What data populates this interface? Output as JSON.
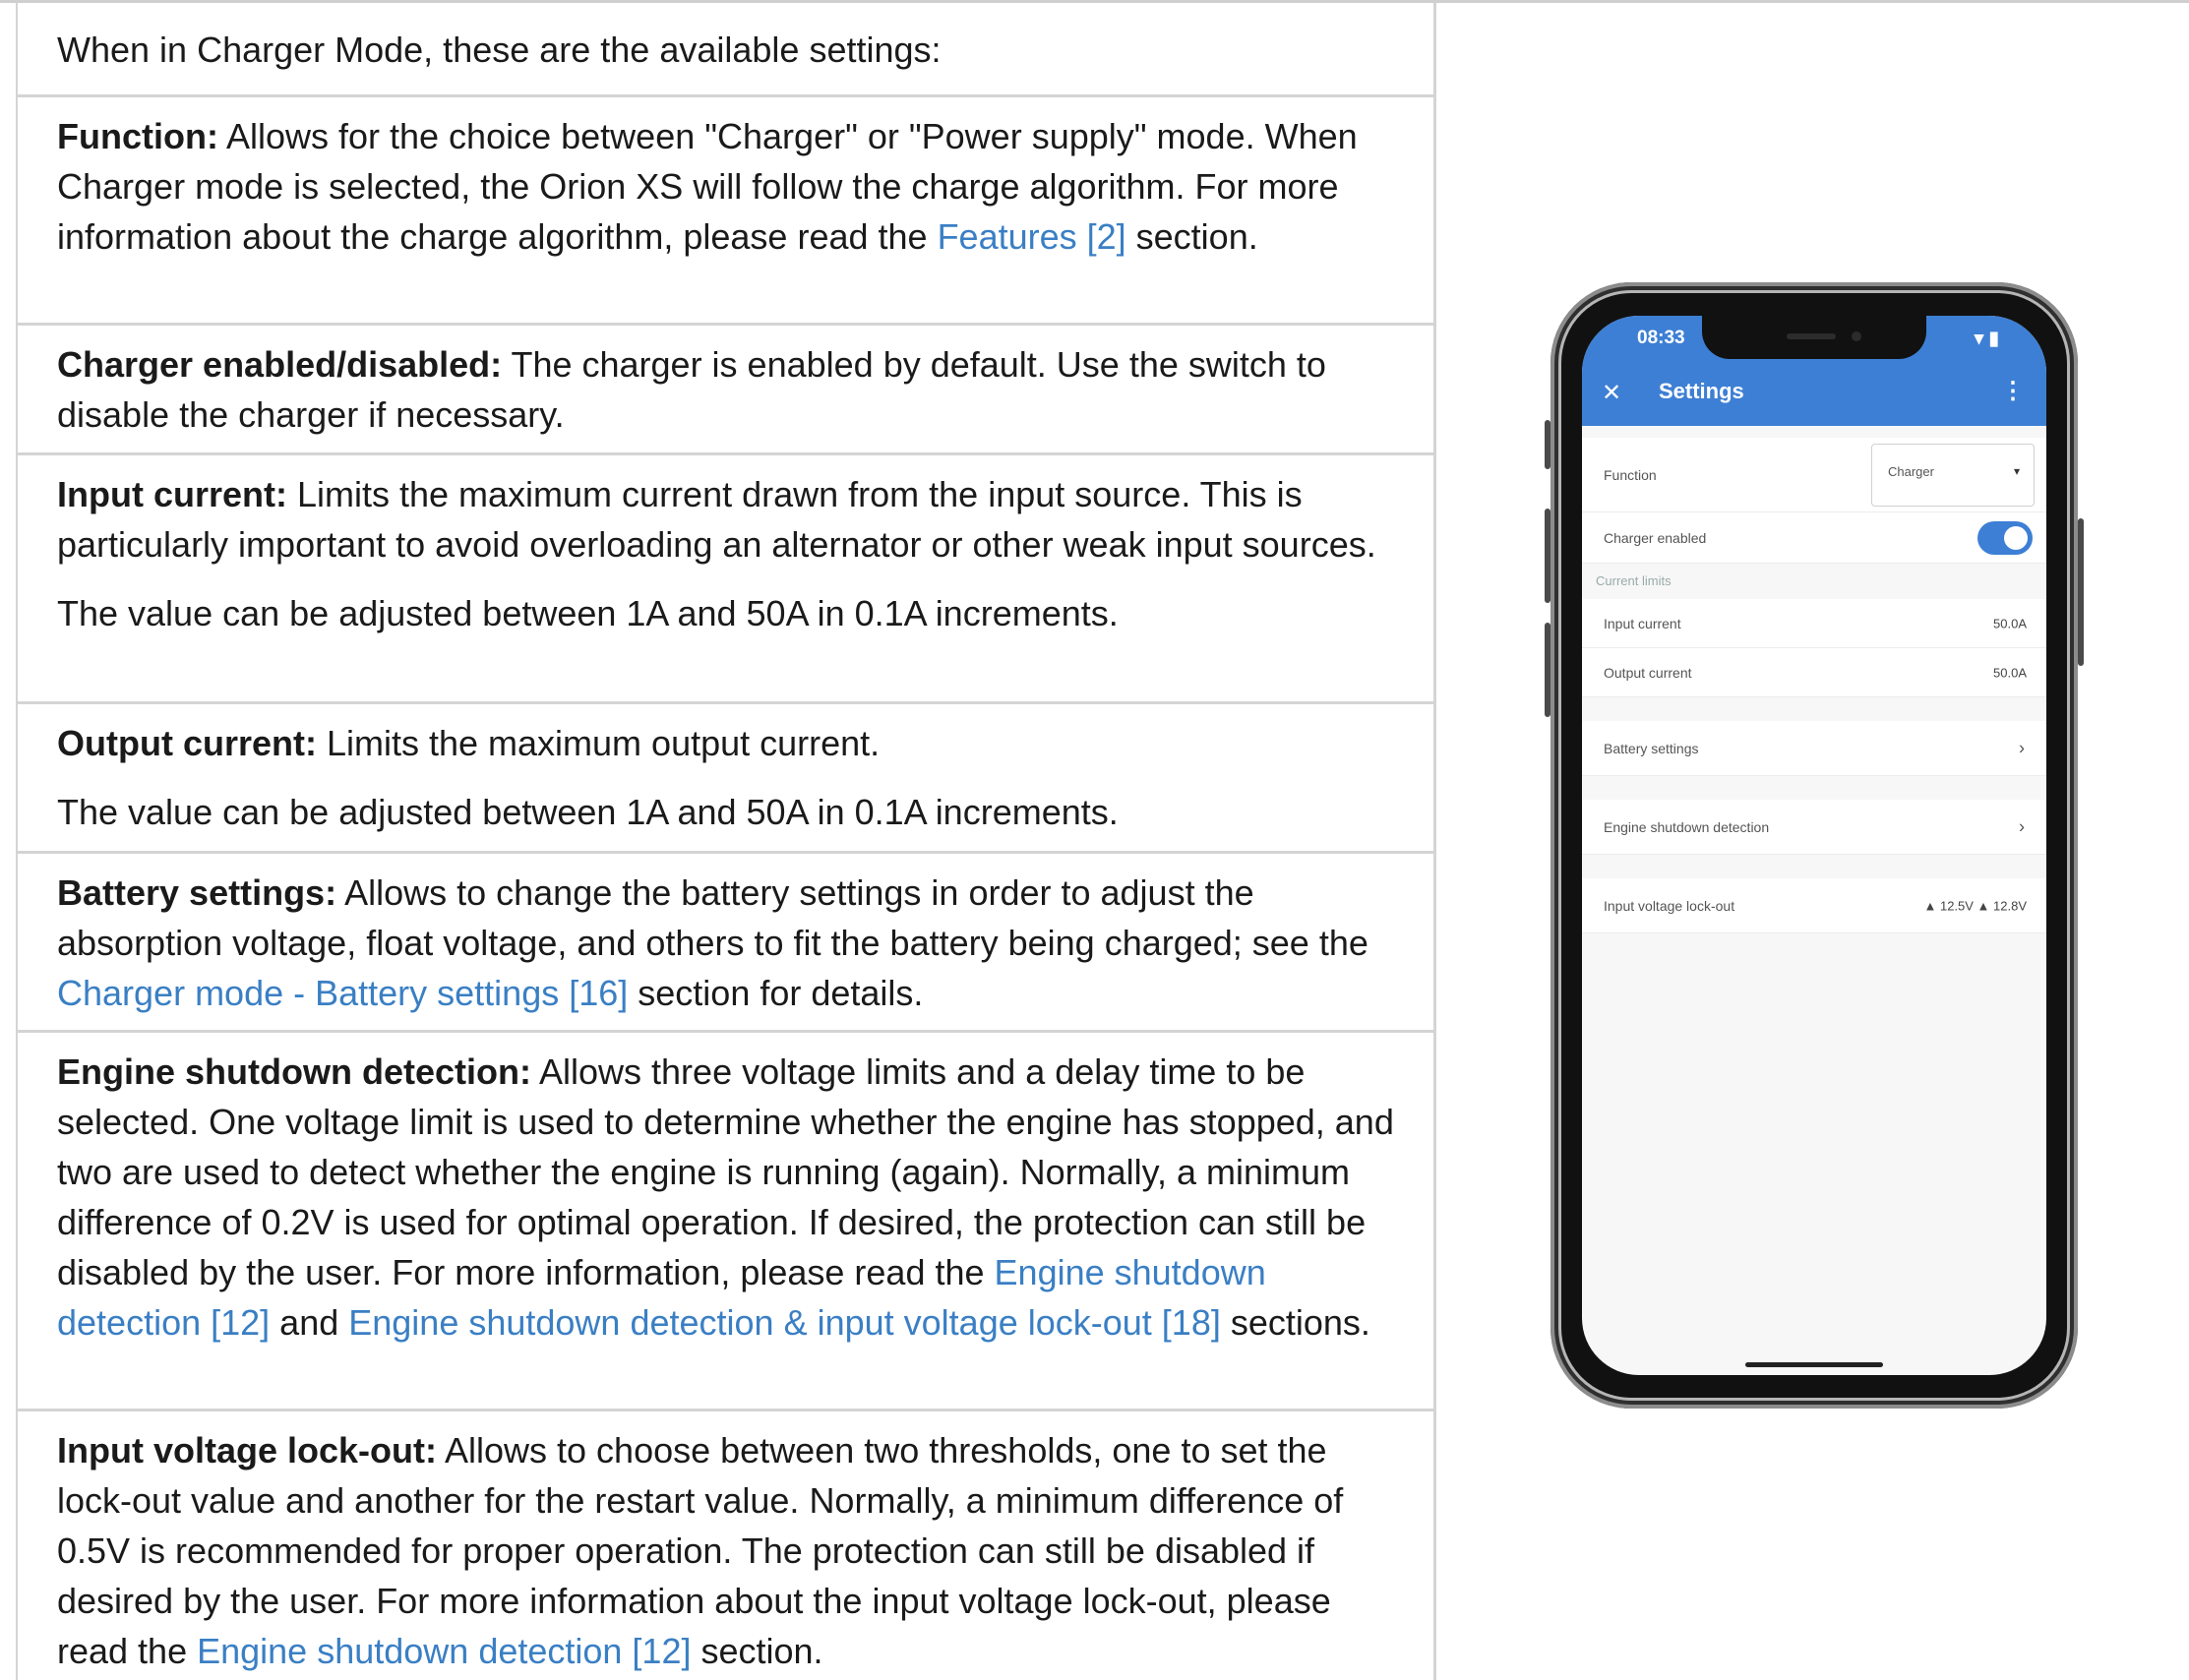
{
  "rows": [
    {
      "text": "When in Charger Mode, these are the available settings:"
    },
    {
      "term": "Function:",
      "text": " Allows for the choice between \"Charger\" or \"Power supply\" mode. When Charger mode is selected, the Orion XS will follow the charge algorithm. For more information about the charge algorithm, please read the ",
      "link1": "Features [2]",
      "tail": " section."
    },
    {
      "term": "Charger enabled/disabled:",
      "text": " The charger is enabled by default. Use the switch to disable the charger if necessary."
    },
    {
      "term": "Input current:",
      "text": " Limits the maximum current drawn from the input source. This is particularly important to avoid overloading an alternator or other weak input sources.",
      "extra": "The value can be adjusted between 1A and 50A in 0.1A increments."
    },
    {
      "term": "Output current:",
      "text": " Limits the maximum output current.",
      "extra": "The value can be adjusted between 1A and 50A in 0.1A increments."
    },
    {
      "term": "Battery settings:",
      "text": " Allows to change the battery settings in order to adjust the absorption voltage, float voltage, and others to fit the battery being charged; see the ",
      "link1": "Charger mode - Battery settings [16]",
      "tail": " section for details."
    },
    {
      "term": "Engine shutdown detection:",
      "text": " Allows three voltage limits and a delay time to be selected. One voltage limit is used to determine whether the engine has stopped, and two are used to detect whether the engine is running (again). Normally, a minimum difference of 0.2V is used for optimal operation. If desired, the protection can still be disabled by the user. For more information, please read the ",
      "link1": "Engine shutdown detection [12]",
      "mid": " and ",
      "link2": "Engine shutdown detection & input voltage lock-out [18]",
      "tail": " sections."
    },
    {
      "term": "Input voltage lock-out:",
      "text": " Allows to choose between two thresholds, one to set the lock-out value and another for the restart value. Normally, a minimum difference of 0.5V is recommended for proper operation. The protection can still be disabled if desired by the user. For more information about the input voltage lock-out, please read the ",
      "link1": "Engine shutdown detection [12]",
      "tail": " section."
    }
  ],
  "phone": {
    "time": "08:33",
    "status_icons": "▾ ▮",
    "close": "✕",
    "title": "Settings",
    "menu": "⋮",
    "function_label": "Function",
    "function_value": "Charger",
    "dropdown_caret": "▾",
    "charger_enabled_label": "Charger enabled",
    "section_current_limits": "Current limits",
    "input_current_label": "Input current",
    "input_current_value": "50.0A",
    "output_current_label": "Output current",
    "output_current_value": "50.0A",
    "battery_settings_label": "Battery settings",
    "engine_shutdown_label": "Engine shutdown detection",
    "input_lockout_label": "Input voltage lock-out",
    "input_lockout_value": "▲ 12.5V  ▲ 12.8V",
    "chevron": "›"
  },
  "colors": {
    "link": "#3a7fc4",
    "app_bar": "#3d7fd4",
    "toggle_on": "#3d7fd4"
  }
}
